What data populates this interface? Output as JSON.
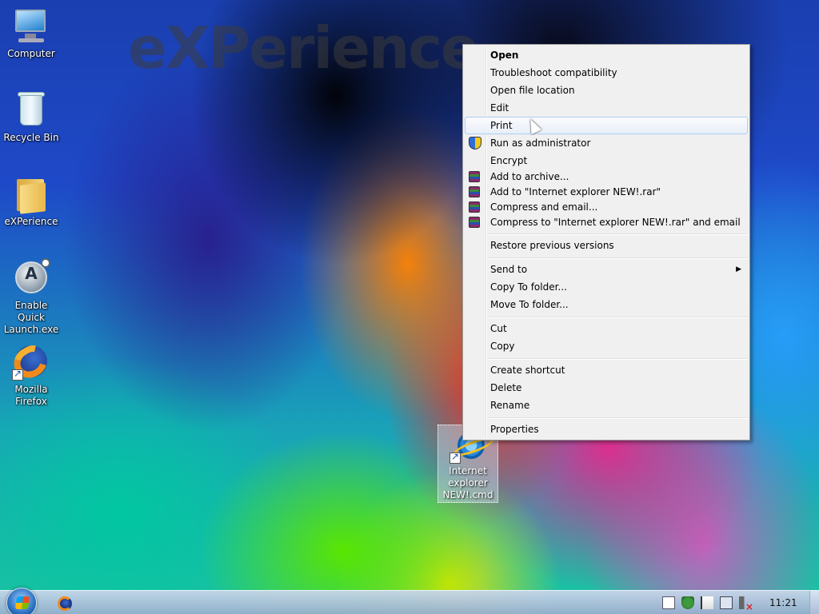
{
  "wallpaper": {
    "watermark": "eXPerience"
  },
  "desktop": {
    "icons": [
      {
        "label": "Computer",
        "icon": "computer-icon"
      },
      {
        "label": "Recycle Bin",
        "icon": "recycle-bin-icon"
      },
      {
        "label": "eXPerience",
        "icon": "folder-icon"
      },
      {
        "label": "Enable Quick Launch.exe",
        "icon": "quick-launch-exe-icon"
      },
      {
        "label": "Mozilla Firefox",
        "icon": "firefox-icon"
      }
    ],
    "selected_icon": {
      "label": "Internet explorer NEW!.cmd",
      "icon": "internet-explorer-icon"
    }
  },
  "context_menu": {
    "items": [
      {
        "label": "Open",
        "bold": true
      },
      {
        "label": "Troubleshoot compatibility"
      },
      {
        "label": "Open file location"
      },
      {
        "label": "Edit"
      },
      {
        "label": "Print",
        "highlighted": true
      },
      {
        "label": "Run as administrator",
        "icon": "uac-shield-icon"
      },
      {
        "label": "Encrypt"
      },
      {
        "label": "Add to archive...",
        "icon": "winrar-icon"
      },
      {
        "label": "Add to \"Internet explorer NEW!.rar\"",
        "icon": "winrar-icon"
      },
      {
        "label": "Compress and email...",
        "icon": "winrar-icon"
      },
      {
        "label": "Compress to \"Internet explorer NEW!.rar\" and email",
        "icon": "winrar-icon"
      },
      {
        "label": "Restore previous versions"
      },
      {
        "label": "Send to",
        "submenu": true
      },
      {
        "label": "Copy To folder..."
      },
      {
        "label": "Move To folder..."
      },
      {
        "label": "Cut"
      },
      {
        "label": "Copy"
      },
      {
        "label": "Create shortcut"
      },
      {
        "label": "Delete"
      },
      {
        "label": "Rename"
      },
      {
        "label": "Properties"
      }
    ],
    "submenu_arrow": "▶"
  },
  "taskbar": {
    "start_button": "windows-start-orb-icon",
    "pinned": [
      "firefox-icon"
    ],
    "tray_icons": [
      "action-center-icon",
      "security-shield-icon",
      "flag-icon",
      "network-icon",
      "volume-muted-icon"
    ],
    "clock": "11:21"
  },
  "colors": {
    "menu_bg": "#f0f0f0",
    "menu_highlight": "#e8eff8",
    "menu_highlight_border": "#aecff7",
    "taskbar": "#b4c6dc"
  }
}
